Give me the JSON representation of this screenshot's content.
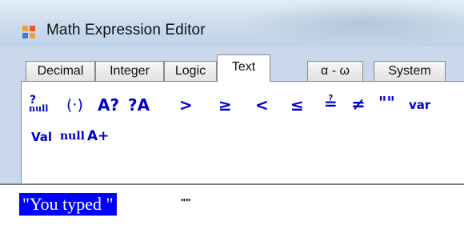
{
  "window": {
    "title": "Math Expression Editor",
    "icon": "app-window-icon"
  },
  "tabs": [
    {
      "label": "Decimal"
    },
    {
      "label": "Integer"
    },
    {
      "label": "Logic"
    },
    {
      "label": "Text",
      "active": true
    },
    {
      "label": "α - ω"
    },
    {
      "label": "System"
    }
  ],
  "text_tab": {
    "tokens_row1": [
      {
        "label": "?",
        "sub": "null",
        "name": "null-check"
      },
      {
        "label": "(·)",
        "name": "parenthesis"
      },
      {
        "label": "A?",
        "name": "a-question"
      },
      {
        "label": "?A",
        "name": "question-a"
      },
      {
        "label": ">",
        "name": "greater-than"
      },
      {
        "label": "≥",
        "name": "greater-equal"
      },
      {
        "label": "<",
        "name": "less-than"
      },
      {
        "label": "≤",
        "name": "less-equal"
      },
      {
        "label": "≟",
        "name": "equal-question"
      },
      {
        "label": "≠",
        "name": "not-equal"
      },
      {
        "label": "\"\"",
        "name": "empty-string"
      },
      {
        "label": "var",
        "name": "var"
      }
    ],
    "tokens_row2": [
      {
        "label": "Val",
        "name": "val"
      },
      {
        "label": "null",
        "name": "null"
      },
      {
        "label": "A+",
        "name": "concat"
      }
    ]
  },
  "editor": {
    "selected_text": "\"You typed \"",
    "next_token": "\"\""
  },
  "colors": {
    "token_blue": "#0000cc",
    "selection_bg": "#0000ff",
    "selection_fg": "#ffffff"
  }
}
